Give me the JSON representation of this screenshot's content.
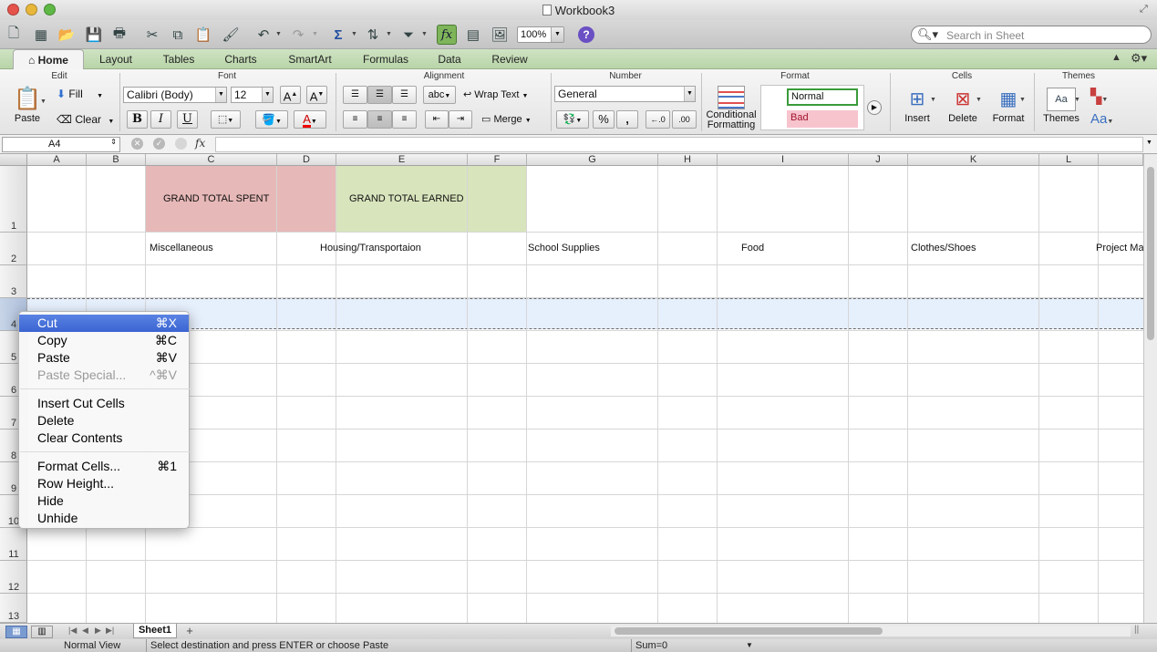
{
  "window": {
    "title": "Workbook3"
  },
  "toolbar": {
    "zoom": "100%",
    "search_placeholder": "Search in Sheet"
  },
  "ribbon_tabs": [
    "Home",
    "Layout",
    "Tables",
    "Charts",
    "SmartArt",
    "Formulas",
    "Data",
    "Review"
  ],
  "groups": {
    "edit": "Edit",
    "font": "Font",
    "alignment": "Alignment",
    "number": "Number",
    "format": "Format",
    "cells": "Cells",
    "themes": "Themes"
  },
  "edit": {
    "paste": "Paste",
    "fill": "Fill",
    "clear": "Clear"
  },
  "font": {
    "name": "Calibri (Body)",
    "size": "12",
    "bold": "B",
    "italic": "I",
    "underline": "U",
    "grow": "A",
    "shrink": "A",
    "color": "A"
  },
  "alignment": {
    "orientation": "abc",
    "wrap": "Wrap Text",
    "merge": "Merge"
  },
  "number": {
    "format": "General",
    "percent": "%",
    "comma": ",",
    "inc": "←.0",
    "dec": ".00"
  },
  "format_group": {
    "conditional_line1": "Conditional",
    "conditional_line2": "Formatting",
    "style_normal": "Normal",
    "style_bad": "Bad"
  },
  "cells_group": {
    "insert": "Insert",
    "delete": "Delete",
    "format": "Format"
  },
  "themes_group": {
    "themes": "Themes",
    "font_sample": "Aa"
  },
  "formula_bar": {
    "name_box": "A4",
    "fx": "fx",
    "content": ""
  },
  "sheet": {
    "columns": [
      "A",
      "B",
      "C",
      "D",
      "E",
      "F",
      "G",
      "H",
      "I",
      "J",
      "K",
      "L"
    ],
    "rows": [
      "1",
      "2",
      "3",
      "4",
      "5",
      "6",
      "7",
      "8",
      "9",
      "10",
      "11",
      "12",
      "13"
    ],
    "cells": {
      "C1": "GRAND TOTAL SPENT",
      "E1": "GRAND TOTAL EARNED",
      "B2": "Miscellaneous",
      "D2": "Housing/Transportaion",
      "F2": "School Supplies",
      "H2": "Food",
      "J2": "Clothes/Shoes",
      "L2": "Project Ma"
    },
    "colors": {
      "spent_fill": "#e6b8b7",
      "earned_fill": "#d8e4bc",
      "selection": "#e6effc"
    }
  },
  "sheet_tabs": [
    "Sheet1"
  ],
  "status": {
    "view": "Normal View",
    "message": "Select destination and press ENTER or choose Paste",
    "sum": "Sum=0"
  },
  "context_menu": {
    "items": [
      {
        "label": "Cut",
        "shortcut": "⌘X"
      },
      {
        "label": "Copy",
        "shortcut": "⌘C"
      },
      {
        "label": "Paste",
        "shortcut": "⌘V"
      },
      {
        "label": "Paste Special...",
        "shortcut": "^⌘V"
      },
      {
        "label": "Insert Cut Cells",
        "shortcut": ""
      },
      {
        "label": "Delete",
        "shortcut": ""
      },
      {
        "label": "Clear Contents",
        "shortcut": ""
      },
      {
        "label": "Format Cells...",
        "shortcut": "⌘1"
      },
      {
        "label": "Row Height...",
        "shortcut": ""
      },
      {
        "label": "Hide",
        "shortcut": ""
      },
      {
        "label": "Unhide",
        "shortcut": ""
      }
    ]
  }
}
